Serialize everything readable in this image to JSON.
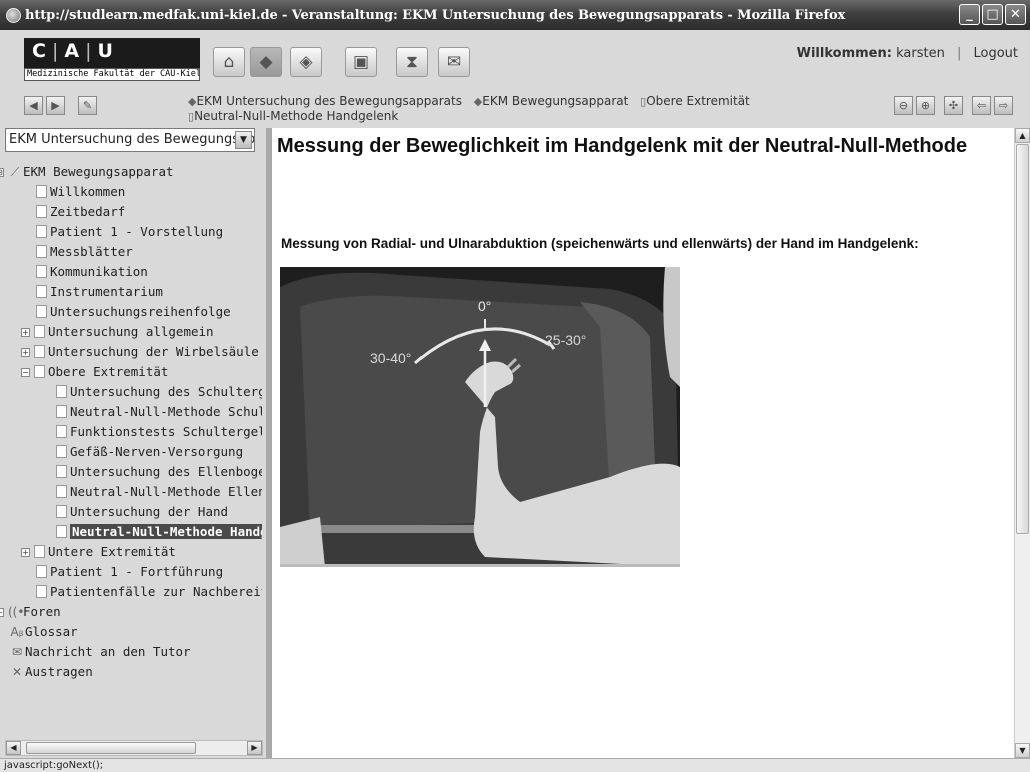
{
  "window": {
    "title": "http://studlearn.medfak.uni-kiel.de - Veranstaltung: EKM Untersuchung des Bewegungsapparats - Mozilla Firefox",
    "minimize": "_",
    "maximize": "□",
    "close": "✕"
  },
  "header": {
    "logo_c": "C",
    "logo_a": "A",
    "logo_u": "U",
    "logo_sep": "|",
    "logo_subtitle": "Medizinische Fakultät der CAU-Kiel",
    "welcome_label": "Willkommen:",
    "username": "karsten",
    "separator": "|",
    "logout": "Logout"
  },
  "breadcrumbs": [
    {
      "label": "EKM Untersuchung des Bewegungsapparats",
      "icon": "course-icon"
    },
    {
      "label": "EKM Bewegungsapparat",
      "icon": "course-icon"
    },
    {
      "label": "Obere Extremität",
      "icon": "page-icon"
    },
    {
      "label": "Neutral-Null-Methode Handgelenk",
      "icon": "page-icon"
    }
  ],
  "sidebar": {
    "select_value": "EKM Untersuchung des Bewegungsapparats",
    "tree": [
      {
        "label": "EKM Bewegungsapparat",
        "level": 0,
        "expander": "⊟",
        "icon": "course"
      },
      {
        "label": "Willkommen",
        "level": 1,
        "icon": "page"
      },
      {
        "label": "Zeitbedarf",
        "level": 1,
        "icon": "page"
      },
      {
        "label": "Patient 1 - Vorstellung",
        "level": 1,
        "icon": "page"
      },
      {
        "label": "Messblätter",
        "level": 1,
        "icon": "page"
      },
      {
        "label": "Kommunikation",
        "level": 1,
        "icon": "page"
      },
      {
        "label": "Instrumentarium",
        "level": 1,
        "icon": "page"
      },
      {
        "label": "Untersuchungsreihenfolge",
        "level": 1,
        "icon": "page"
      },
      {
        "label": "Untersuchung allgemein",
        "level": 1,
        "expander": "+",
        "icon": "page"
      },
      {
        "label": "Untersuchung der Wirbelsäule",
        "level": 1,
        "expander": "+",
        "icon": "page"
      },
      {
        "label": "Obere Extremität",
        "level": 1,
        "expander": "−",
        "icon": "page"
      },
      {
        "label": "Untersuchung des Schultergelenks",
        "level": 2,
        "icon": "page"
      },
      {
        "label": "Neutral-Null-Methode Schultergelenk",
        "level": 2,
        "icon": "page"
      },
      {
        "label": "Funktionstests Schultergelenk",
        "level": 2,
        "icon": "page"
      },
      {
        "label": "Gefäß-Nerven-Versorgung",
        "level": 2,
        "icon": "page"
      },
      {
        "label": "Untersuchung des Ellenbogens",
        "level": 2,
        "icon": "page"
      },
      {
        "label": "Neutral-Null-Methode Ellenbogen",
        "level": 2,
        "icon": "page"
      },
      {
        "label": "Untersuchung der Hand",
        "level": 2,
        "icon": "page"
      },
      {
        "label": "Neutral-Null-Methode Handgelenk",
        "level": 2,
        "icon": "page",
        "selected": true
      },
      {
        "label": "Untere Extremität",
        "level": 1,
        "expander": "+",
        "icon": "page"
      },
      {
        "label": "Patient 1 - Fortführung",
        "level": 1,
        "icon": "page"
      },
      {
        "label": "Patientenfälle zur Nachbereitung",
        "level": 1,
        "icon": "page"
      },
      {
        "label": "Foren",
        "level": 0,
        "expander": "+",
        "icon": "forum"
      },
      {
        "label": "Glossar",
        "level": 0,
        "icon": "glossary"
      },
      {
        "label": "Nachricht an den Tutor",
        "level": 0,
        "icon": "mail"
      },
      {
        "label": "Austragen",
        "level": 0,
        "icon": "close"
      }
    ]
  },
  "content": {
    "title": "Messung der Beweglichkeit im Handgelenk mit der Neutral-Null-Methode",
    "subheading": "Messung von Radial- und Ulnarabduktion (speichenwärts und ellenwärts) der Hand im Handgelenk:",
    "image_labels": {
      "center": "0°",
      "left": "30-40°",
      "right": "25-30°"
    }
  },
  "statusbar": {
    "text": "javascript:goNext();"
  }
}
